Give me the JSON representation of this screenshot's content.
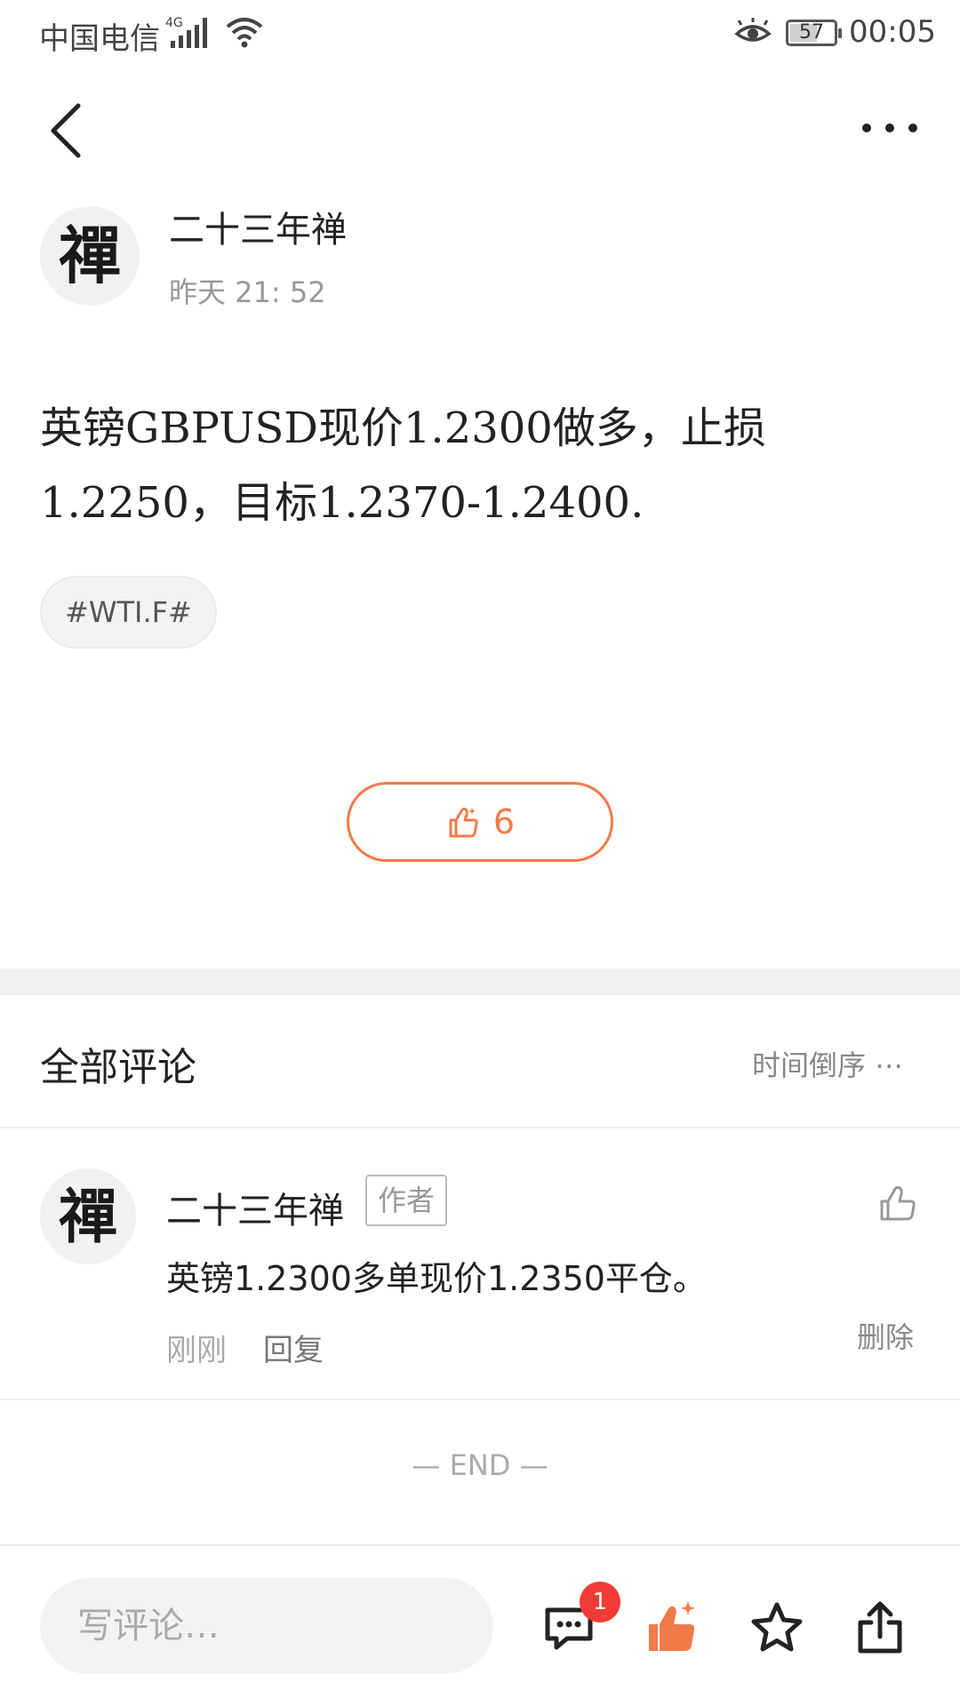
{
  "status_bar": {
    "carrier": "中国电信",
    "network": "4G",
    "battery": "57",
    "time": "00:05"
  },
  "nav": {
    "back_icon": "chevron-left-icon",
    "more_icon": "ellipsis-icon"
  },
  "post": {
    "avatar_char": "禪",
    "author": "二十三年禅",
    "time": "昨天 21: 52",
    "body": "英镑GBPUSD现价1.2300做多，止损1.2250，目标1.2370-1.2400.",
    "tag": "#WTI.F#",
    "like_count": "6"
  },
  "comments_section": {
    "title": "全部评论",
    "sort_label": "时间倒序",
    "items": [
      {
        "avatar_char": "禪",
        "author": "二十三年禅",
        "badge": "作者",
        "text": "英镑1.2300多单现价1.2350平仓。",
        "time": "刚刚",
        "reply_label": "回复",
        "delete_label": "删除"
      }
    ],
    "end_marker": "— END —"
  },
  "bottom_bar": {
    "input_placeholder": "写评论…",
    "comment_badge": "1",
    "icons": [
      "comment-icon",
      "thumbs-up-icon",
      "star-icon",
      "share-icon"
    ]
  },
  "colors": {
    "accent": "#f07a4a",
    "badge_red": "#f33b35",
    "divider": "#f2f2f2"
  }
}
